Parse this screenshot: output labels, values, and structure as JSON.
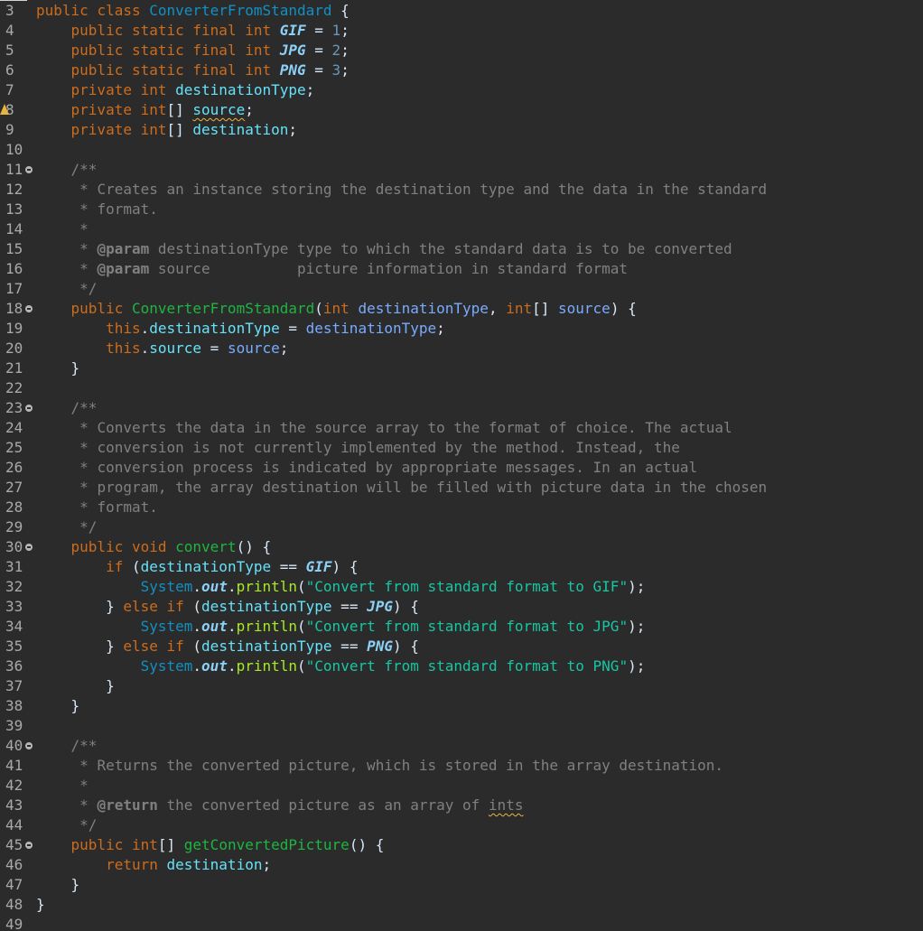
{
  "editor": {
    "theme": "dark",
    "language": "java",
    "colors": {
      "background": "#2b2b2b",
      "keyword": "#cc6c1d",
      "class": "#1290c3",
      "constant": "#8dd0f5",
      "field": "#66e1f8",
      "method": "#1eb540",
      "string": "#17c6a3",
      "comment": "#808080"
    },
    "lines": [
      {
        "n": "3",
        "fold": false,
        "warn": false,
        "tokens": [
          [
            "kw",
            "public "
          ],
          [
            "kw",
            "class "
          ],
          [
            "cls",
            "ConverterFromStandard"
          ],
          [
            "plain",
            " {"
          ]
        ]
      },
      {
        "n": "4",
        "fold": false,
        "warn": false,
        "tokens": [
          [
            "plain",
            "    "
          ],
          [
            "kw",
            "public "
          ],
          [
            "kw",
            "static "
          ],
          [
            "kw",
            "final "
          ],
          [
            "kw",
            "int "
          ],
          [
            "cst",
            "GIF"
          ],
          [
            "plain",
            " = "
          ],
          [
            "num",
            "1"
          ],
          [
            "plain",
            ";"
          ]
        ]
      },
      {
        "n": "5",
        "fold": false,
        "warn": false,
        "tokens": [
          [
            "plain",
            "    "
          ],
          [
            "kw",
            "public "
          ],
          [
            "kw",
            "static "
          ],
          [
            "kw",
            "final "
          ],
          [
            "kw",
            "int "
          ],
          [
            "cst",
            "JPG"
          ],
          [
            "plain",
            " = "
          ],
          [
            "num",
            "2"
          ],
          [
            "plain",
            ";"
          ]
        ]
      },
      {
        "n": "6",
        "fold": false,
        "warn": false,
        "tokens": [
          [
            "plain",
            "    "
          ],
          [
            "kw",
            "public "
          ],
          [
            "kw",
            "static "
          ],
          [
            "kw",
            "final "
          ],
          [
            "kw",
            "int "
          ],
          [
            "cst",
            "PNG"
          ],
          [
            "plain",
            " = "
          ],
          [
            "num",
            "3"
          ],
          [
            "plain",
            ";"
          ]
        ]
      },
      {
        "n": "7",
        "fold": false,
        "warn": false,
        "tokens": [
          [
            "plain",
            "    "
          ],
          [
            "kw",
            "private "
          ],
          [
            "kw",
            "int "
          ],
          [
            "fld",
            "destinationType"
          ],
          [
            "plain",
            ";"
          ]
        ]
      },
      {
        "n": "8",
        "fold": false,
        "warn": true,
        "tokens": [
          [
            "plain",
            "    "
          ],
          [
            "kw",
            "private "
          ],
          [
            "kw",
            "int"
          ],
          [
            "plain",
            "[] "
          ],
          [
            "fld squig",
            "source"
          ],
          [
            "plain",
            ";"
          ]
        ]
      },
      {
        "n": "9",
        "fold": false,
        "warn": false,
        "tokens": [
          [
            "plain",
            "    "
          ],
          [
            "kw",
            "private "
          ],
          [
            "kw",
            "int"
          ],
          [
            "plain",
            "[] "
          ],
          [
            "fld",
            "destination"
          ],
          [
            "plain",
            ";"
          ]
        ]
      },
      {
        "n": "10",
        "fold": false,
        "warn": false,
        "tokens": []
      },
      {
        "n": "11",
        "fold": true,
        "warn": false,
        "tokens": [
          [
            "plain",
            "    "
          ],
          [
            "doc",
            "/**"
          ]
        ]
      },
      {
        "n": "12",
        "fold": false,
        "warn": false,
        "tokens": [
          [
            "plain",
            "     "
          ],
          [
            "doc",
            "* Creates an instance storing the destination type and the data in the standard"
          ]
        ]
      },
      {
        "n": "13",
        "fold": false,
        "warn": false,
        "tokens": [
          [
            "plain",
            "     "
          ],
          [
            "doc",
            "* format."
          ]
        ]
      },
      {
        "n": "14",
        "fold": false,
        "warn": false,
        "tokens": [
          [
            "plain",
            "     "
          ],
          [
            "doc",
            "*"
          ]
        ]
      },
      {
        "n": "15",
        "fold": false,
        "warn": false,
        "tokens": [
          [
            "plain",
            "     "
          ],
          [
            "doc",
            "* "
          ],
          [
            "tag",
            "@param"
          ],
          [
            "doc",
            " destinationType type to which the standard data is to be converted"
          ]
        ]
      },
      {
        "n": "16",
        "fold": false,
        "warn": false,
        "tokens": [
          [
            "plain",
            "     "
          ],
          [
            "doc",
            "* "
          ],
          [
            "tag",
            "@param"
          ],
          [
            "doc",
            " source          picture information in standard format"
          ]
        ]
      },
      {
        "n": "17",
        "fold": false,
        "warn": false,
        "tokens": [
          [
            "plain",
            "     "
          ],
          [
            "doc",
            "*/"
          ]
        ]
      },
      {
        "n": "18",
        "fold": true,
        "warn": false,
        "tokens": [
          [
            "plain",
            "    "
          ],
          [
            "kw",
            "public "
          ],
          [
            "mth",
            "ConverterFromStandard"
          ],
          [
            "plain",
            "("
          ],
          [
            "kw",
            "int "
          ],
          [
            "var",
            "destinationType"
          ],
          [
            "plain",
            ", "
          ],
          [
            "kw",
            "int"
          ],
          [
            "plain",
            "[] "
          ],
          [
            "var",
            "source"
          ],
          [
            "plain",
            ") {"
          ]
        ]
      },
      {
        "n": "19",
        "fold": false,
        "warn": false,
        "tokens": [
          [
            "plain",
            "        "
          ],
          [
            "kw",
            "this"
          ],
          [
            "plain",
            "."
          ],
          [
            "fld",
            "destinationType"
          ],
          [
            "plain",
            " = "
          ],
          [
            "var",
            "destinationType"
          ],
          [
            "plain",
            ";"
          ]
        ]
      },
      {
        "n": "20",
        "fold": false,
        "warn": false,
        "tokens": [
          [
            "plain",
            "        "
          ],
          [
            "kw",
            "this"
          ],
          [
            "plain",
            "."
          ],
          [
            "fld",
            "source"
          ],
          [
            "plain",
            " = "
          ],
          [
            "var",
            "source"
          ],
          [
            "plain",
            ";"
          ]
        ]
      },
      {
        "n": "21",
        "fold": false,
        "warn": false,
        "tokens": [
          [
            "plain",
            "    }"
          ]
        ]
      },
      {
        "n": "22",
        "fold": false,
        "warn": false,
        "tokens": []
      },
      {
        "n": "23",
        "fold": true,
        "warn": false,
        "tokens": [
          [
            "plain",
            "    "
          ],
          [
            "doc",
            "/**"
          ]
        ]
      },
      {
        "n": "24",
        "fold": false,
        "warn": false,
        "tokens": [
          [
            "plain",
            "     "
          ],
          [
            "doc",
            "* Converts the data in the source array to the format of choice. The actual"
          ]
        ]
      },
      {
        "n": "25",
        "fold": false,
        "warn": false,
        "tokens": [
          [
            "plain",
            "     "
          ],
          [
            "doc",
            "* conversion is not currently implemented by the method. Instead, the"
          ]
        ]
      },
      {
        "n": "26",
        "fold": false,
        "warn": false,
        "tokens": [
          [
            "plain",
            "     "
          ],
          [
            "doc",
            "* conversion process is indicated by appropriate messages. In an actual"
          ]
        ]
      },
      {
        "n": "27",
        "fold": false,
        "warn": false,
        "tokens": [
          [
            "plain",
            "     "
          ],
          [
            "doc",
            "* program, the array destination will be filled with picture data in the chosen"
          ]
        ]
      },
      {
        "n": "28",
        "fold": false,
        "warn": false,
        "tokens": [
          [
            "plain",
            "     "
          ],
          [
            "doc",
            "* format."
          ]
        ]
      },
      {
        "n": "29",
        "fold": false,
        "warn": false,
        "tokens": [
          [
            "plain",
            "     "
          ],
          [
            "doc",
            "*/"
          ]
        ]
      },
      {
        "n": "30",
        "fold": true,
        "warn": false,
        "tokens": [
          [
            "plain",
            "    "
          ],
          [
            "kw",
            "public "
          ],
          [
            "kw",
            "void "
          ],
          [
            "mth",
            "convert"
          ],
          [
            "plain",
            "() {"
          ]
        ]
      },
      {
        "n": "31",
        "fold": false,
        "warn": false,
        "tokens": [
          [
            "plain",
            "        "
          ],
          [
            "kw",
            "if "
          ],
          [
            "plain",
            "("
          ],
          [
            "fld",
            "destinationType"
          ],
          [
            "plain",
            " == "
          ],
          [
            "cst",
            "GIF"
          ],
          [
            "plain",
            ") {"
          ]
        ]
      },
      {
        "n": "32",
        "fold": false,
        "warn": false,
        "tokens": [
          [
            "plain",
            "            "
          ],
          [
            "sys",
            "System"
          ],
          [
            "plain",
            "."
          ],
          [
            "out",
            "out"
          ],
          [
            "plain",
            "."
          ],
          [
            "mcall",
            "println"
          ],
          [
            "plain",
            "("
          ],
          [
            "str",
            "\"Convert from standard format to GIF\""
          ],
          [
            "plain",
            ");"
          ]
        ]
      },
      {
        "n": "33",
        "fold": false,
        "warn": false,
        "tokens": [
          [
            "plain",
            "        } "
          ],
          [
            "kw",
            "else "
          ],
          [
            "kw",
            "if "
          ],
          [
            "plain",
            "("
          ],
          [
            "fld",
            "destinationType"
          ],
          [
            "plain",
            " == "
          ],
          [
            "cst",
            "JPG"
          ],
          [
            "plain",
            ") {"
          ]
        ]
      },
      {
        "n": "34",
        "fold": false,
        "warn": false,
        "tokens": [
          [
            "plain",
            "            "
          ],
          [
            "sys",
            "System"
          ],
          [
            "plain",
            "."
          ],
          [
            "out",
            "out"
          ],
          [
            "plain",
            "."
          ],
          [
            "mcall",
            "println"
          ],
          [
            "plain",
            "("
          ],
          [
            "str",
            "\"Convert from standard format to JPG\""
          ],
          [
            "plain",
            ");"
          ]
        ]
      },
      {
        "n": "35",
        "fold": false,
        "warn": false,
        "tokens": [
          [
            "plain",
            "        } "
          ],
          [
            "kw",
            "else "
          ],
          [
            "kw",
            "if "
          ],
          [
            "plain",
            "("
          ],
          [
            "fld",
            "destinationType"
          ],
          [
            "plain",
            " == "
          ],
          [
            "cst",
            "PNG"
          ],
          [
            "plain",
            ") {"
          ]
        ]
      },
      {
        "n": "36",
        "fold": false,
        "warn": false,
        "tokens": [
          [
            "plain",
            "            "
          ],
          [
            "sys",
            "System"
          ],
          [
            "plain",
            "."
          ],
          [
            "out",
            "out"
          ],
          [
            "plain",
            "."
          ],
          [
            "mcall",
            "println"
          ],
          [
            "plain",
            "("
          ],
          [
            "str",
            "\"Convert from standard format to PNG\""
          ],
          [
            "plain",
            ");"
          ]
        ]
      },
      {
        "n": "37",
        "fold": false,
        "warn": false,
        "tokens": [
          [
            "plain",
            "        }"
          ]
        ]
      },
      {
        "n": "38",
        "fold": false,
        "warn": false,
        "tokens": [
          [
            "plain",
            "    }"
          ]
        ]
      },
      {
        "n": "39",
        "fold": false,
        "warn": false,
        "tokens": []
      },
      {
        "n": "40",
        "fold": true,
        "warn": false,
        "tokens": [
          [
            "plain",
            "    "
          ],
          [
            "doc",
            "/**"
          ]
        ]
      },
      {
        "n": "41",
        "fold": false,
        "warn": false,
        "tokens": [
          [
            "plain",
            "     "
          ],
          [
            "doc",
            "* Returns the converted picture, which is stored in the array destination."
          ]
        ]
      },
      {
        "n": "42",
        "fold": false,
        "warn": false,
        "tokens": [
          [
            "plain",
            "     "
          ],
          [
            "doc",
            "*"
          ]
        ]
      },
      {
        "n": "43",
        "fold": false,
        "warn": false,
        "tokens": [
          [
            "plain",
            "     "
          ],
          [
            "doc",
            "* "
          ],
          [
            "tag",
            "@return"
          ],
          [
            "doc",
            " the converted picture as an array of "
          ],
          [
            "doc squig",
            "ints"
          ]
        ]
      },
      {
        "n": "44",
        "fold": false,
        "warn": false,
        "tokens": [
          [
            "plain",
            "     "
          ],
          [
            "doc",
            "*/"
          ]
        ]
      },
      {
        "n": "45",
        "fold": true,
        "warn": false,
        "tokens": [
          [
            "plain",
            "    "
          ],
          [
            "kw",
            "public "
          ],
          [
            "kw",
            "int"
          ],
          [
            "plain",
            "[] "
          ],
          [
            "mth",
            "getConvertedPicture"
          ],
          [
            "plain",
            "() {"
          ]
        ]
      },
      {
        "n": "46",
        "fold": false,
        "warn": false,
        "tokens": [
          [
            "plain",
            "        "
          ],
          [
            "kw",
            "return "
          ],
          [
            "fld",
            "destination"
          ],
          [
            "plain",
            ";"
          ]
        ]
      },
      {
        "n": "47",
        "fold": false,
        "warn": false,
        "tokens": [
          [
            "plain",
            "    }"
          ]
        ]
      },
      {
        "n": "48",
        "fold": false,
        "warn": false,
        "tokens": [
          [
            "plain",
            "}"
          ]
        ]
      },
      {
        "n": "49",
        "fold": false,
        "warn": false,
        "tokens": []
      }
    ]
  }
}
